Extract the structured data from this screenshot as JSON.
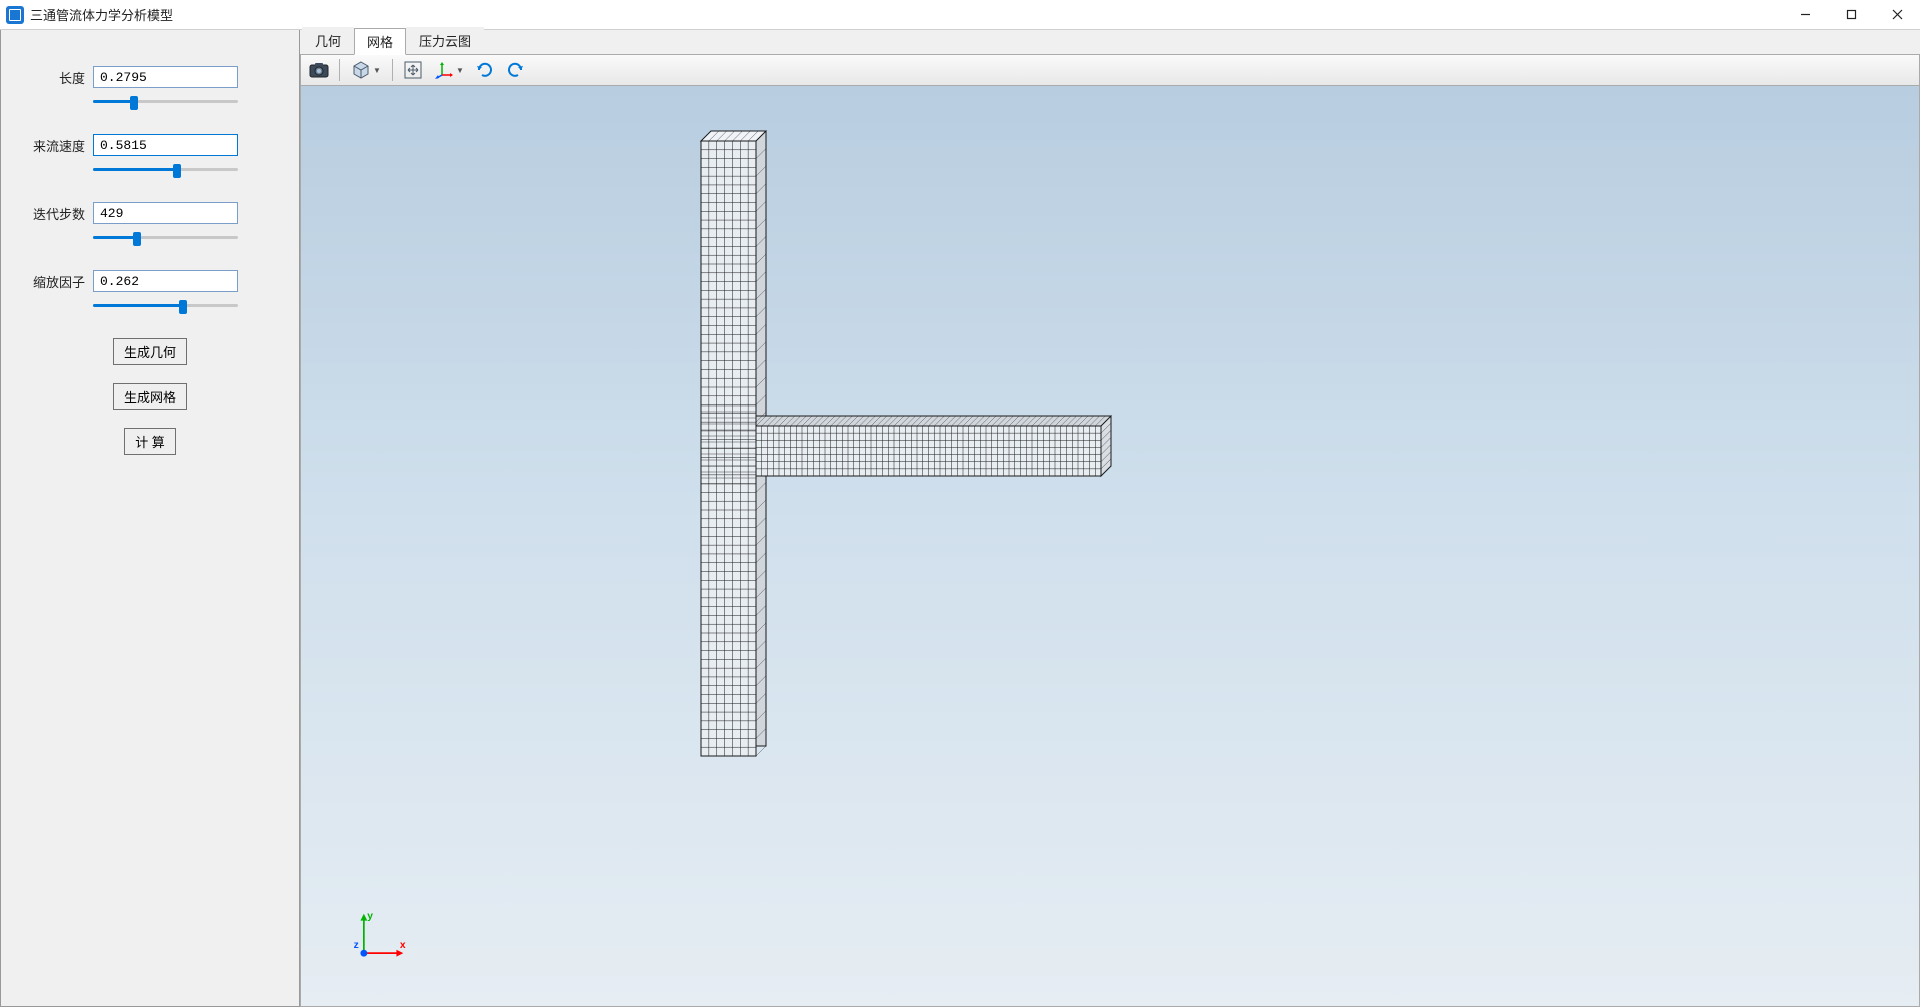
{
  "app_title": "三通管流体力学分析模型",
  "window_controls": {
    "minimize": "min",
    "maximize": "max",
    "close": "close"
  },
  "tabs": [
    {
      "label": "几何",
      "active": false
    },
    {
      "label": "网格",
      "active": true
    },
    {
      "label": "压力云图",
      "active": false
    }
  ],
  "toolbar": {
    "camera": "camera-icon",
    "cube": "cube-icon",
    "move": "move-icon",
    "axes_rotate": "axes-rotate-icon",
    "rotate_ccw": "rotate-ccw-icon",
    "rotate_cw": "rotate-cw-icon"
  },
  "parameters": [
    {
      "label": "长度",
      "value": "0.2795",
      "slider_pct": 28,
      "active": false
    },
    {
      "label": "来流速度",
      "value": "0.5815",
      "slider_pct": 58,
      "active": true
    },
    {
      "label": "迭代步数",
      "value": "429",
      "slider_pct": 30,
      "active": false
    },
    {
      "label": "缩放因子",
      "value": "0.262",
      "slider_pct": 62,
      "active": false
    }
  ],
  "buttons": {
    "gen_geometry": "生成几何",
    "gen_mesh": "生成网格",
    "compute": "计 算"
  },
  "axis_labels": {
    "x": "x",
    "y": "y",
    "z": "z"
  },
  "colors": {
    "accent": "#0078d7",
    "x_axis": "#ff0000",
    "y_axis": "#00b400",
    "z_axis": "#0055ff",
    "viewport_grad_top": "#b8cde0",
    "viewport_grad_bottom": "#e6edf3"
  }
}
